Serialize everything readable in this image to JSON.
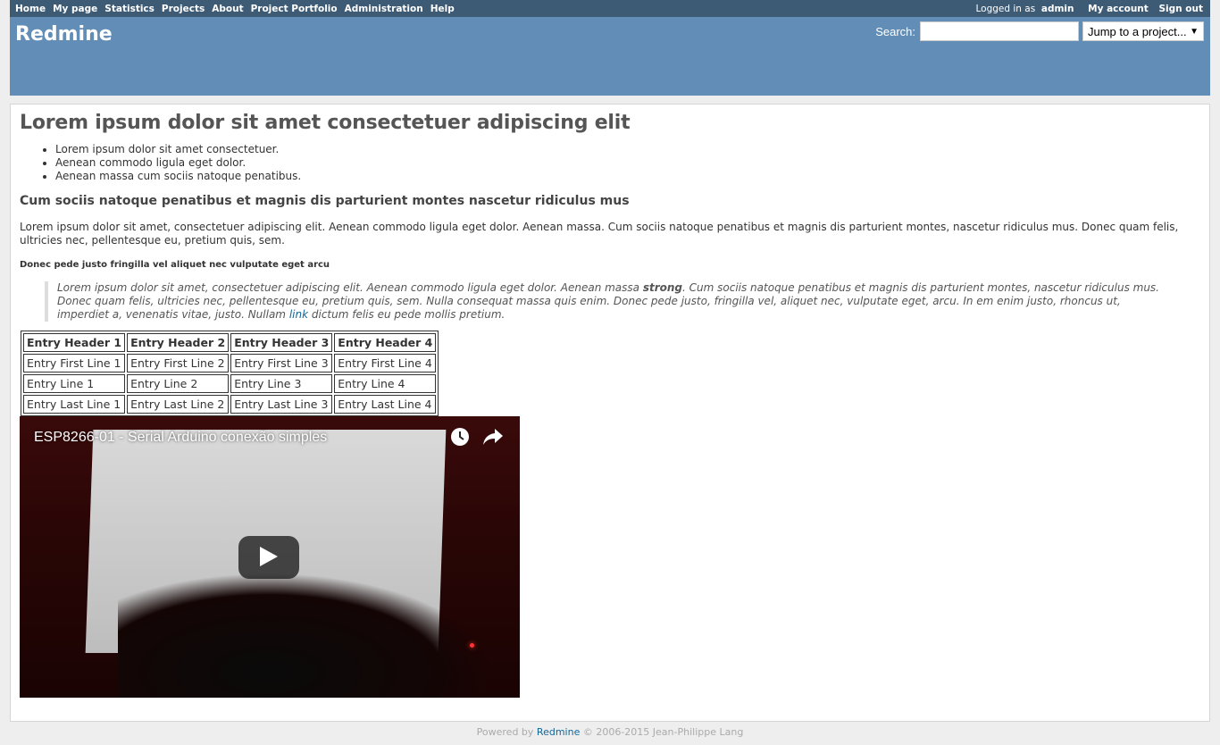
{
  "top_menu": {
    "items": [
      "Home",
      "My page",
      "Statistics",
      "Projects",
      "About",
      "Project Portfolio",
      "Administration",
      "Help"
    ],
    "logged_in_label": "Logged in as",
    "user": "admin",
    "my_account": "My account",
    "sign_out": "Sign out"
  },
  "header": {
    "title": "Redmine",
    "search_label": "Search:",
    "search_value": "",
    "project_jump": "Jump to a project..."
  },
  "content": {
    "title": "Lorem ipsum dolor sit amet consectetuer adipiscing elit",
    "list": [
      "Lorem ipsum dolor sit amet consectetuer.",
      "Aenean commodo ligula eget dolor.",
      "Aenean massa cum sociis natoque penatibus."
    ],
    "subheading": "Cum sociis natoque penatibus et magnis dis parturient montes nascetur ridiculus mus",
    "paragraph": "Lorem ipsum dolor sit amet, consectetuer adipiscing elit. Aenean commodo ligula eget dolor. Aenean massa. Cum sociis natoque penatibus et magnis dis parturient montes, nascetur ridiculus mus. Donec quam felis, ultricies nec, pellentesque eu, pretium quis, sem.",
    "small_heading": "Donec pede justo fringilla vel aliquet nec vulputate eget arcu",
    "quote_part1": "Lorem ipsum dolor sit amet, consectetuer adipiscing elit. Aenean commodo ligula eget dolor. Aenean massa ",
    "quote_strong": "strong",
    "quote_part2": ". Cum sociis natoque penatibus et magnis dis parturient montes, nascetur ridiculus mus. Donec quam felis, ultricies nec, pellentesque eu, pretium quis, sem. Nulla consequat massa quis enim. Donec pede justo, fringilla vel, aliquet nec, vulputate eget, arcu. In em enim justo, rhoncus ut, imperdiet a, venenatis vitae, justo. Nullam ",
    "quote_link": "link",
    "quote_part3": " dictum felis eu pede mollis pretium."
  },
  "table": {
    "headers": [
      "Entry Header 1",
      "Entry Header 2",
      "Entry Header 3",
      "Entry Header 4"
    ],
    "rows": [
      [
        "Entry First Line 1",
        "Entry First Line 2",
        "Entry First Line 3",
        "Entry First Line 4"
      ],
      [
        "Entry Line 1",
        "Entry Line 2",
        "Entry Line 3",
        "Entry Line 4"
      ],
      [
        "Entry Last Line 1",
        "Entry Last Line 2",
        "Entry Last Line 3",
        "Entry Last Line 4"
      ]
    ]
  },
  "video": {
    "title": "ESP8266-01 - Serial Arduino conexão simples",
    "icons": [
      "clock-icon",
      "share-icon",
      "play-icon"
    ]
  },
  "footer": {
    "powered_by": "Powered by",
    "link": "Redmine",
    "copyright": "© 2006-2015 Jean-Philippe Lang"
  }
}
